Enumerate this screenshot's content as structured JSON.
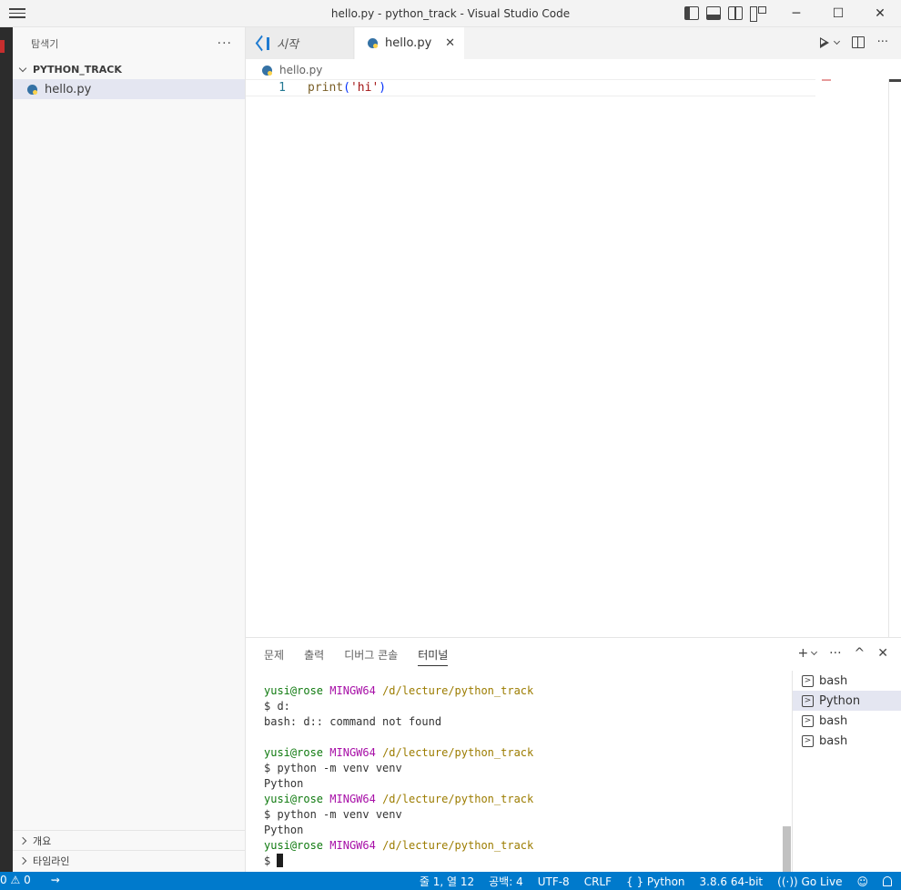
{
  "window": {
    "title": "hello.py - python_track - Visual Studio Code",
    "minimize": "─",
    "maximize": "☐",
    "close": "✕"
  },
  "sidebar": {
    "title": "탐색기",
    "more": "···",
    "folder": "PYTHON_TRACK",
    "file": "hello.py",
    "outline": "개요",
    "timeline": "타임라인"
  },
  "tabs": [
    {
      "label": "시작"
    },
    {
      "label": "hello.py"
    }
  ],
  "tab_close": "✕",
  "tab_more": "···",
  "breadcrumb": "hello.py",
  "editor": {
    "line_number": "1",
    "code_fn": "print",
    "code_open": "(",
    "code_str": "'hi'",
    "code_close": ")"
  },
  "panel": {
    "tabs": [
      "문제",
      "출력",
      "디버그 콘솔",
      "터미널"
    ],
    "add": "+",
    "more": "···",
    "up": "^",
    "close": "✕"
  },
  "terminal": {
    "user": "yusi@rose",
    "host": "MINGW64",
    "path": "/d/lecture/python_track",
    "lines": [
      "$ d:",
      "bash: d:: command not found",
      "",
      "$ python -m venv venv",
      "Python",
      "$ python -m venv venv",
      "Python",
      "$ "
    ]
  },
  "terminal_list": [
    "bash",
    "Python",
    "bash",
    "bash"
  ],
  "statusbar": {
    "errors": "0",
    "warnings": "0",
    "position": "줄 1, 열 12",
    "spaces": "공백: 4",
    "encoding": "UTF-8",
    "eol": "CRLF",
    "language": "Python",
    "interpreter": "3.8.6 64-bit",
    "golive": "Go Live"
  }
}
